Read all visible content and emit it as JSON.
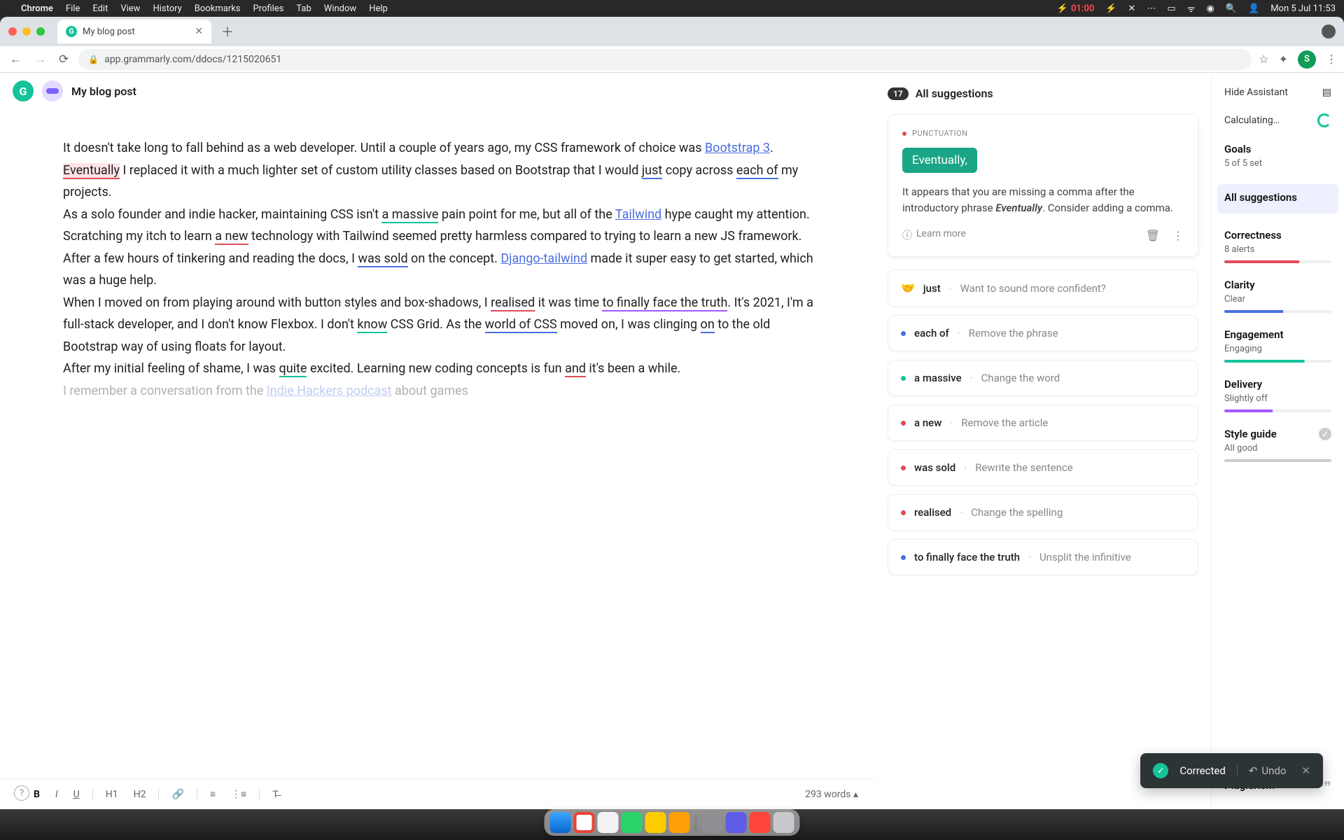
{
  "menubar": {
    "app": "Chrome",
    "items": [
      "File",
      "Edit",
      "View",
      "History",
      "Bookmarks",
      "Profiles",
      "Tab",
      "Window",
      "Help"
    ],
    "battery_time": "01:00",
    "datetime": "Mon 5 Jul  11:53"
  },
  "browser": {
    "tab_title": "My blog post",
    "url": "app.grammarly.com/ddocs/1215020651",
    "avatar_letter": "S"
  },
  "doc": {
    "title": "My blog post",
    "para1": {
      "t1": "It doesn't take long to fall behind as a web developer. Until a couple of years ago, my CSS framework of choice was ",
      "link1": "Bootstrap 3",
      "t2": ". ",
      "hl": "Eventually",
      "t3": " I replaced it with a much lighter set of custom utility classes based on Bootstrap that I would ",
      "u_just": "just",
      "t4": " copy across ",
      "u_each": "each of",
      "t5": " my projects."
    },
    "para2": {
      "t1": "As a solo founder and indie hacker, maintaining CSS isn't ",
      "u_massive": "a massive",
      "t2": " pain point for me, but all of the ",
      "link1": "Tailwind",
      "t3": " hype caught my attention. Scratching my itch to learn ",
      "u_anew": "a new",
      "t4": " technology with Tailwind seemed pretty harmless compared to trying to learn a new JS framework."
    },
    "para3": {
      "t1": "After a few hours of tinkering and reading the docs, I ",
      "u_sold": "was sold",
      "t2": " on the concept. ",
      "link1": "Django-tailwind",
      "t3": " made it super easy to get started, which was a huge help."
    },
    "para4": {
      "t1": "When I moved on from playing around with button styles and box-shadows, I ",
      "u_realised": "realised",
      "t2": " it was time ",
      "u_finally": "to finally face the truth",
      "t3": ". It's 2021, I'm a full-stack developer, and I don't know Flexbox. I don't ",
      "u_know": "know",
      "t4": " CSS Grid. As the ",
      "u_world": "world of CSS",
      "t5": " moved on, I was clinging ",
      "u_on": "on",
      "t6": " to the old Bootstrap way of using floats for layout."
    },
    "para5": {
      "t1": "After my initial feeling of shame, I was ",
      "u_quite": "quite",
      "t2": " excited. Learning new coding concepts is fun ",
      "u_and": "and",
      "t3": " it's been a while."
    },
    "para6": {
      "t1": "I remember a conversation from the ",
      "link1": "Indie Hackers podcast",
      "t2": " about games"
    },
    "word_count": "293 words"
  },
  "suggestions": {
    "header": "All suggestions",
    "count": "17",
    "main_card": {
      "category": "PUNCTUATION",
      "chip": "Eventually,",
      "explain_pre": "It appears that you are missing a comma after the introductory phrase ",
      "explain_em": "Eventually",
      "explain_post": ". Consider adding a comma.",
      "learn_more": "Learn more"
    },
    "rows": [
      {
        "emoji": "🤝",
        "kw": "just",
        "hint": "Want to sound more confident?"
      },
      {
        "dot": "blue",
        "kw": "each of",
        "hint": "Remove the phrase"
      },
      {
        "dot": "green",
        "kw": "a massive",
        "hint": "Change the word"
      },
      {
        "dot": "red",
        "kw": "a new",
        "hint": "Remove the article"
      },
      {
        "dot": "red",
        "kw": "was sold",
        "hint": "Rewrite the sentence"
      },
      {
        "dot": "red",
        "kw": "realised",
        "hint": "Change the spelling"
      },
      {
        "dot": "blue",
        "kw": "to finally face the truth",
        "hint": "Unsplit the infinitive"
      }
    ]
  },
  "sidebar": {
    "hide": "Hide Assistant",
    "calculating": "Calculating…",
    "goals_title": "Goals",
    "goals_sub": "5 of 5 set",
    "all": "All suggestions",
    "correctness_title": "Correctness",
    "correctness_sub": "8 alerts",
    "clarity_title": "Clarity",
    "clarity_sub": "Clear",
    "engagement_title": "Engagement",
    "engagement_sub": "Engaging",
    "delivery_title": "Delivery",
    "delivery_sub": "Slightly off",
    "style_title": "Style guide",
    "style_sub": "All good",
    "plagiarism": "Plagiarism"
  },
  "toast": {
    "label": "Corrected",
    "undo": "Undo"
  },
  "footer": {
    "b": "B",
    "i": "I",
    "u": "U",
    "h1": "H1",
    "h2": "H2"
  }
}
